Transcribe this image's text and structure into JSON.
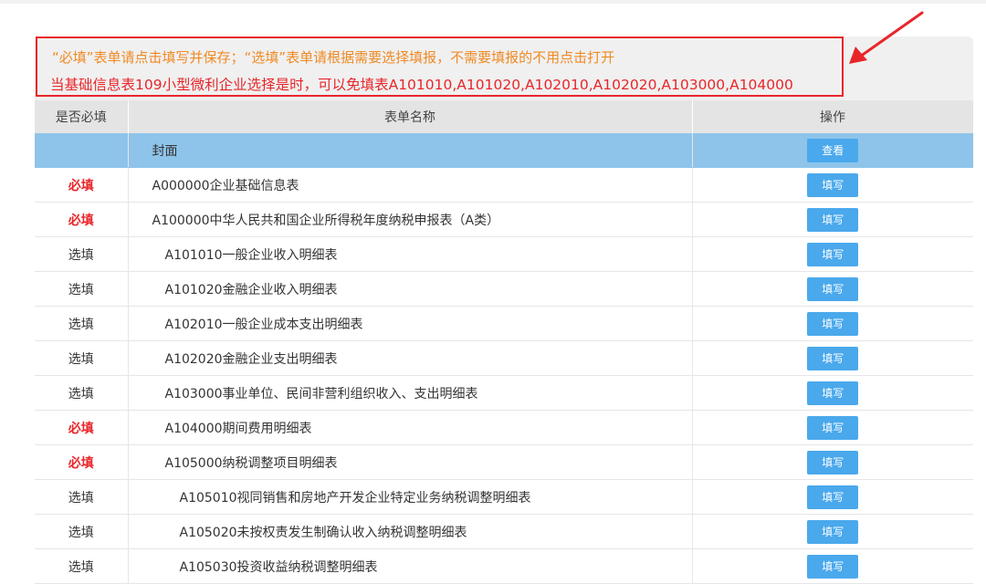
{
  "notice": {
    "line1": "“必填”表单请点击填写并保存；“选填”表单请根据需要选择填报，不需要填报的不用点击打开",
    "line2": "当基础信息表109小型微利企业选择是时，可以免填表A101010,A101020,A102010,A102020,A103000,A104000",
    "line1_color": "#f08a24",
    "line2_color": "#e8262a",
    "border_color": "#e8262a"
  },
  "table": {
    "headers": [
      "是否必填",
      "表单名称",
      "操作"
    ],
    "rows": [
      {
        "required": "",
        "name": "封面",
        "action": "查看",
        "level": 0,
        "highlight": true,
        "must": false
      },
      {
        "required": "必填",
        "name": "A000000企业基础信息表",
        "action": "填写",
        "level": 0,
        "must": true
      },
      {
        "required": "必填",
        "name": "A100000中华人民共和国企业所得税年度纳税申报表（A类）",
        "action": "填写",
        "level": 0,
        "must": true
      },
      {
        "required": "选填",
        "name": "A101010一般企业收入明细表",
        "action": "填写",
        "level": 1,
        "must": false
      },
      {
        "required": "选填",
        "name": "A101020金融企业收入明细表",
        "action": "填写",
        "level": 1,
        "must": false
      },
      {
        "required": "选填",
        "name": "A102010一般企业成本支出明细表",
        "action": "填写",
        "level": 1,
        "must": false
      },
      {
        "required": "选填",
        "name": "A102020金融企业支出明细表",
        "action": "填写",
        "level": 1,
        "must": false
      },
      {
        "required": "选填",
        "name": "A103000事业单位、民间非营利组织收入、支出明细表",
        "action": "填写",
        "level": 1,
        "must": false
      },
      {
        "required": "必填",
        "name": "A104000期间费用明细表",
        "action": "填写",
        "level": 1,
        "must": true
      },
      {
        "required": "必填",
        "name": "A105000纳税调整项目明细表",
        "action": "填写",
        "level": 1,
        "must": true
      },
      {
        "required": "选填",
        "name": "A105010视同销售和房地产开发企业特定业务纳税调整明细表",
        "action": "填写",
        "level": 2,
        "must": false
      },
      {
        "required": "选填",
        "name": "A105020未按权责发生制确认收入纳税调整明细表",
        "action": "填写",
        "level": 2,
        "must": false
      },
      {
        "required": "选填",
        "name": "A105030投资收益纳税调整明细表",
        "action": "填写",
        "level": 2,
        "must": false
      }
    ]
  },
  "colors": {
    "must_text": "#e8262a",
    "button_bg": "#4aa8ec",
    "highlight_row": "#8ec4ea",
    "header_bg": "#e4e4e4"
  },
  "annotation": {
    "icon": "red-arrow-icon"
  }
}
